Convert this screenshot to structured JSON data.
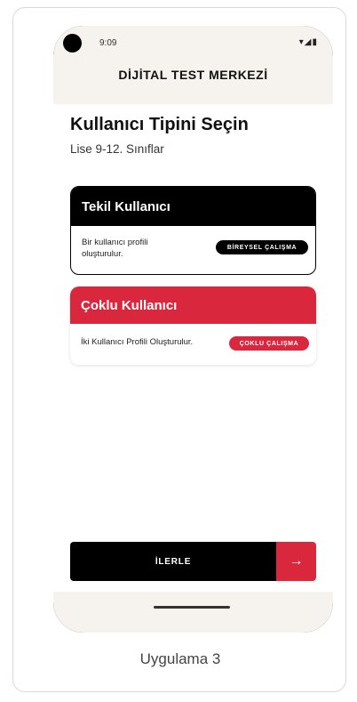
{
  "status_bar": {
    "time": "9:09",
    "icons": "▾◢▮"
  },
  "header": {
    "title": "DİJİTAL TEST MERKEZİ"
  },
  "main": {
    "heading": "Kullanıcı Tipini Seçin",
    "subheading": "Lise 9-12. Sınıflar",
    "options": [
      {
        "title": "Tekil Kullanıcı",
        "description": "Bir kullanıcı profili oluşturulur.",
        "button": "BİREYSEL ÇALIŞMA"
      },
      {
        "title": "Çoklu Kullanıcı",
        "description": "İki Kullanıcı Profili Oluşturulur.",
        "button": "ÇOKLU ÇALIŞMA"
      }
    ]
  },
  "footer": {
    "next_label": "İLERLE",
    "arrow": "→"
  },
  "caption": "Uygulama 3",
  "colors": {
    "accent": "#d9283e",
    "header_bg": "#f6f3ee",
    "dark": "#000000"
  }
}
